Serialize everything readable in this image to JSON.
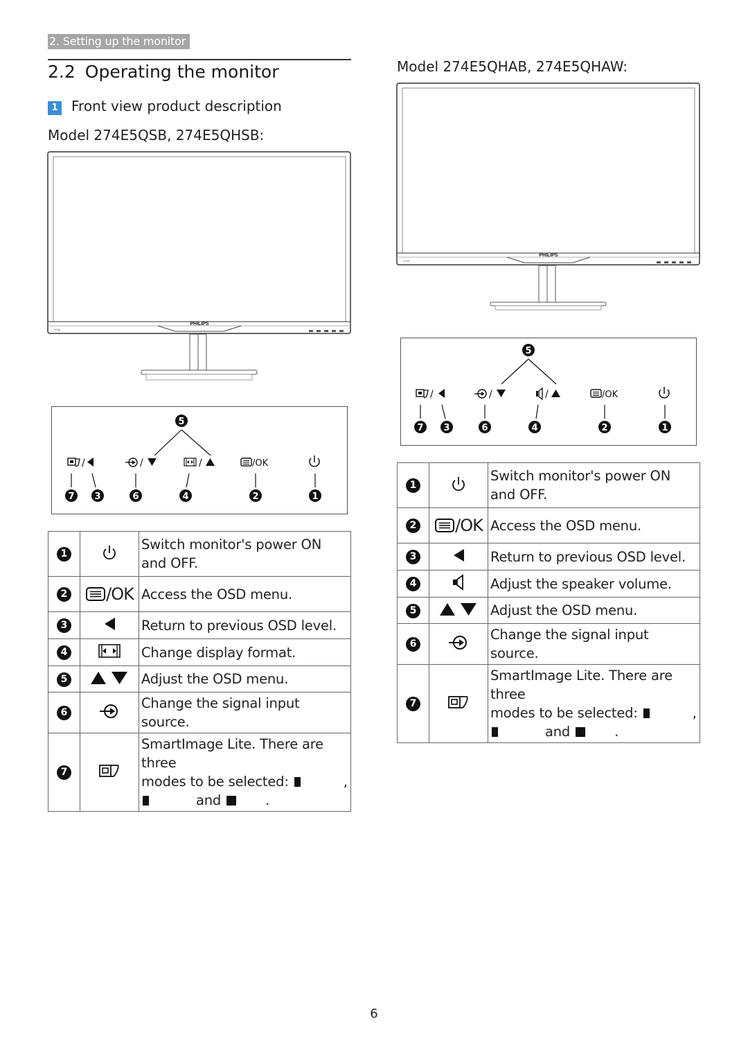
{
  "header": {
    "breadcrumb": "2. Setting up the monitor",
    "section_number": "2.2",
    "section_title": "Operating the monitor",
    "subsection_badge": "1",
    "subsection_title": "Front view product description"
  },
  "models": [
    {
      "title": "Model 274E5QSB, 274E5QHSB:",
      "monitor": {
        "brand": "PHILIPS",
        "model_label": "274E"
      },
      "panel": {
        "callout_top": "5",
        "buttons": [
          {
            "icon": "smartimage-icon",
            "sep": "/",
            "alt_icon": "left-triangle-icon",
            "callouts": [
              "7",
              "3"
            ]
          },
          {
            "icon": "input-icon",
            "sep": "/",
            "alt_icon": "down-triangle-icon",
            "callouts": [
              "6"
            ]
          },
          {
            "icon": "format-icon",
            "sep": "/",
            "alt_icon": "up-triangle-icon",
            "callouts": [
              "4"
            ]
          },
          {
            "icon": "menu-icon",
            "sep": "/",
            "alt_label": "OK",
            "callouts": [
              "2"
            ]
          },
          {
            "icon": "power-icon",
            "callouts": [
              "1"
            ]
          }
        ]
      },
      "table": [
        {
          "num": "1",
          "icon": "power-icon",
          "desc": "Switch monitor's power ON and OFF."
        },
        {
          "num": "2",
          "icon": "menu-ok-icon",
          "icon_label": "/OK",
          "desc": "Access the OSD menu."
        },
        {
          "num": "3",
          "icon": "left-triangle-icon",
          "desc": "Return to previous OSD level."
        },
        {
          "num": "4",
          "icon": "display-format-icon",
          "desc": "Change display format."
        },
        {
          "num": "5",
          "icon": "up-down-triangles-icon",
          "desc": "Adjust the OSD menu."
        },
        {
          "num": "6",
          "icon": "input-source-icon",
          "desc": "Change the signal input source."
        },
        {
          "num": "7",
          "icon": "smartimage-icon",
          "desc_line1": "SmartImage Lite. There are three",
          "desc_line2": "modes to be selected:",
          "desc_comma": ",",
          "desc_and": "and",
          "desc_end": "."
        }
      ]
    },
    {
      "title": "Model 274E5QHAB, 274E5QHAW:",
      "monitor": {
        "brand": "PHILIPS",
        "model_label": "274E"
      },
      "panel": {
        "callout_top": "5",
        "buttons": [
          {
            "icon": "smartimage-icon",
            "sep": "/",
            "alt_icon": "left-triangle-icon",
            "callouts": [
              "7",
              "3"
            ]
          },
          {
            "icon": "input-icon",
            "sep": "/",
            "alt_icon": "down-triangle-icon",
            "callouts": [
              "6"
            ]
          },
          {
            "icon": "speaker-icon",
            "sep": "/",
            "alt_icon": "up-triangle-icon",
            "callouts": [
              "4"
            ]
          },
          {
            "icon": "menu-icon",
            "sep": "/",
            "alt_label": "OK",
            "callouts": [
              "2"
            ]
          },
          {
            "icon": "power-icon",
            "callouts": [
              "1"
            ]
          }
        ]
      },
      "table": [
        {
          "num": "1",
          "icon": "power-icon",
          "desc": "Switch monitor's power ON and OFF."
        },
        {
          "num": "2",
          "icon": "menu-ok-icon",
          "icon_label": "/OK",
          "desc": "Access the OSD menu."
        },
        {
          "num": "3",
          "icon": "left-triangle-icon",
          "desc": "Return to previous OSD level."
        },
        {
          "num": "4",
          "icon": "speaker-icon",
          "desc": "Adjust the speaker volume."
        },
        {
          "num": "5",
          "icon": "up-down-triangles-icon",
          "desc": "Adjust the OSD menu."
        },
        {
          "num": "6",
          "icon": "input-source-icon",
          "desc": "Change the signal input source."
        },
        {
          "num": "7",
          "icon": "smartimage-icon",
          "desc_line1": "SmartImage Lite. There are three",
          "desc_line2": "modes to be selected:",
          "desc_comma": ",",
          "desc_and": "and",
          "desc_end": "."
        }
      ]
    }
  ],
  "footer": {
    "page_number": "6"
  }
}
